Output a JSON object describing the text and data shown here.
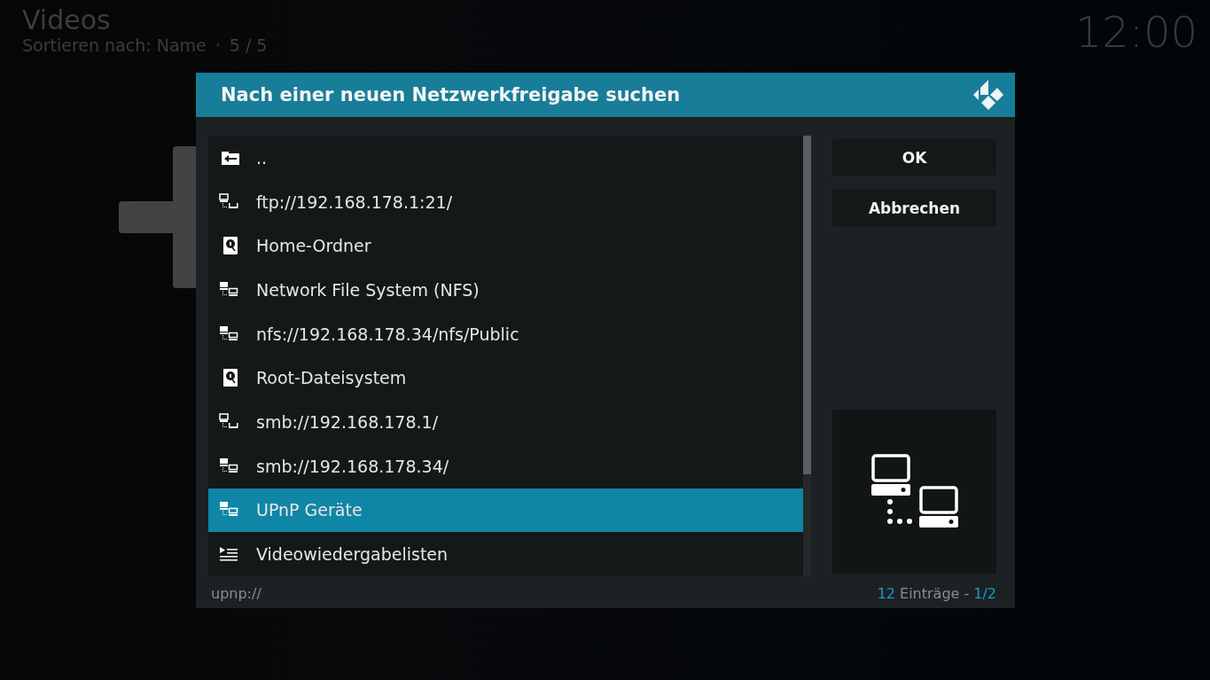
{
  "header": {
    "title": "Videos",
    "sort": "Sortieren nach: Name",
    "separator": "·",
    "count": "5 / 5"
  },
  "clock": "12:00",
  "dialog": {
    "title": "Nach einer neuen Netzwerkfreigabe suchen",
    "items": [
      {
        "label": "..",
        "kind": "parent",
        "selected": false
      },
      {
        "label": "ftp://192.168.178.1:21/",
        "kind": "server",
        "selected": false
      },
      {
        "label": "Home-Ordner",
        "kind": "drive",
        "selected": false
      },
      {
        "label": "Network File System (NFS)",
        "kind": "network",
        "selected": false
      },
      {
        "label": "nfs://192.168.178.34/nfs/Public",
        "kind": "network",
        "selected": false
      },
      {
        "label": "Root-Dateisystem",
        "kind": "drive",
        "selected": false
      },
      {
        "label": "smb://192.168.178.1/",
        "kind": "server",
        "selected": false
      },
      {
        "label": "smb://192.168.178.34/",
        "kind": "network",
        "selected": false
      },
      {
        "label": "UPnP Geräte",
        "kind": "network",
        "selected": true
      },
      {
        "label": "Videowiedergabelisten",
        "kind": "playlist",
        "selected": false
      }
    ],
    "buttons": [
      "OK",
      "Abbrechen"
    ],
    "path": "upnp://",
    "footer": {
      "count": "12",
      "label": "Einträge -",
      "page": "1/2"
    }
  }
}
